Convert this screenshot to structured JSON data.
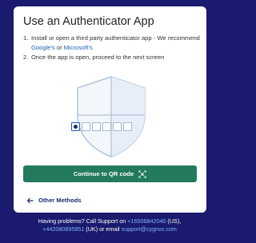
{
  "card": {
    "title": "Use an Authenticator App",
    "steps": [
      {
        "number": "1.",
        "text_before": "Install or open a third party authenticator app - We recommend ",
        "link1": "Google's",
        "text_middle": " or ",
        "link2": "Microsoft's"
      },
      {
        "number": "2.",
        "text": "Once the app is open, proceed to the next screen"
      }
    ],
    "primary_button": "Continue to QR code",
    "back_link": "Other Methods"
  },
  "footer": {
    "line1_prefix": "Having problems? Call Support on ",
    "phone_us": "+16506842040",
    "us_suffix": " (US),",
    "phone_uk": "+442080895851",
    "line2_mid": " (UK) or email ",
    "email": "support@cygnvx.com"
  },
  "colors": {
    "background": "#1a1a6e",
    "accent": "#237a5e",
    "link": "#1a5fb4"
  },
  "icons": [
    "shield-illustration",
    "qr-scan-icon",
    "arrow-left-icon"
  ],
  "code_boxes": {
    "total": 6,
    "filled": 1
  }
}
